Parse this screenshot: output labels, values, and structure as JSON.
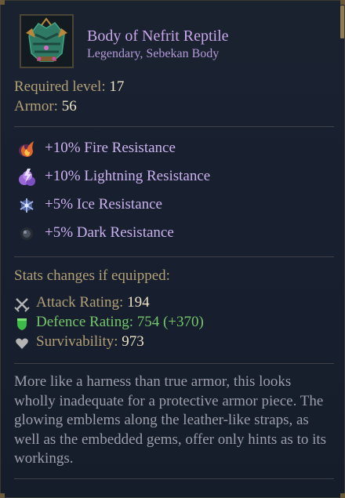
{
  "item": {
    "icon": "nefrit-reptile-armor-icon",
    "name": "Body of Nefrit Reptile",
    "rarity_line": "Legendary, Sebekan Body",
    "required_level_label": "Required level: ",
    "required_level_value": "17",
    "armor_label": "Armor: ",
    "armor_value": "56"
  },
  "resistances": [
    {
      "icon": "fire-icon",
      "label": "+10% Fire Resistance"
    },
    {
      "icon": "lightning-icon",
      "label": "+10% Lightning Resistance"
    },
    {
      "icon": "ice-icon",
      "label": "+5% Ice Resistance"
    },
    {
      "icon": "dark-icon",
      "label": "+5% Dark Resistance"
    }
  ],
  "stats": {
    "heading": "Stats changes if equipped:",
    "rows": [
      {
        "icon": "crossed-swords-icon",
        "label": "Attack Rating: ",
        "value": "194"
      },
      {
        "icon": "shield-icon",
        "label": "Defence Rating: ",
        "value": "754 (+370)"
      },
      {
        "icon": "heart-icon",
        "label": "Survivability: ",
        "value": "973"
      }
    ]
  },
  "description": "More like a harness than true armor, this looks wholly inadequate for a protective armor piece. The glowing emblems along the leather-like straps, as well as the embedded gems, offer only hints as to its workings.",
  "colors": {
    "legendary": "#c8a6ea",
    "label": "#b2a076",
    "value": "#ede3c7",
    "increase": "#74c66a",
    "flavor": "#9c9ea9"
  }
}
